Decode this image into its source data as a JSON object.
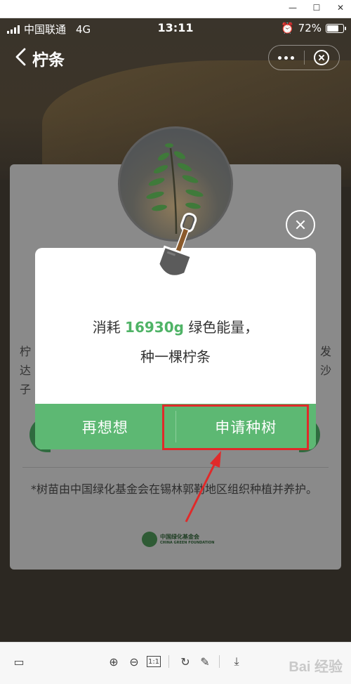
{
  "status_bar": {
    "carrier": "中国联通",
    "network": "4G",
    "time": "13:11",
    "battery_text": "72%",
    "battery_level": 0.72
  },
  "nav": {
    "title": "柠条"
  },
  "background_card": {
    "line1_left": "柠",
    "line1_right": "发",
    "line2_left": "达",
    "line2_right": "沙",
    "line3_left": "子",
    "note": "*树苗由中国绿化基金会在锡林郭勒地区组织种植并养护。",
    "logo_text_cn": "中国绿化基金会",
    "logo_text_en": "CHINA GREEN FOUNDATION"
  },
  "dialog": {
    "text_prefix": "消耗",
    "energy_value": "16930g",
    "text_suffix": "绿色能量，",
    "line2": "种一棵柠条",
    "cancel_label": "再想想",
    "confirm_label": "申请种树"
  },
  "colors": {
    "accent_green": "#5db873",
    "energy_green": "#4fb366",
    "highlight_red": "#e02a2a"
  },
  "watermark": "Bai 经验"
}
